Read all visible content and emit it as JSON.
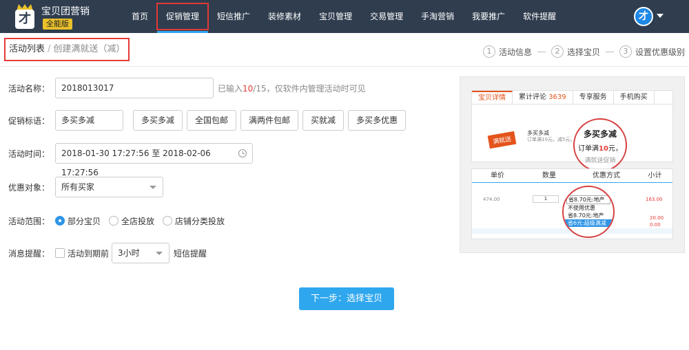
{
  "app": {
    "title": "宝贝团营销",
    "badge": "全能版",
    "logo_char": "才"
  },
  "nav": {
    "items": [
      {
        "label": "首页"
      },
      {
        "label": "促销管理",
        "active": true
      },
      {
        "label": "短信推广"
      },
      {
        "label": "装修素材"
      },
      {
        "label": "宝贝管理"
      },
      {
        "label": "交易管理"
      },
      {
        "label": "手淘营销"
      },
      {
        "label": "我要推广"
      },
      {
        "label": "软件提醒"
      }
    ]
  },
  "user": {
    "avatar_char": "才"
  },
  "breadcrumb": {
    "parent": "活动列表",
    "separator": "/",
    "current": "创建满就送（减）"
  },
  "steps": [
    {
      "num": "1",
      "label": "活动信息"
    },
    {
      "num": "2",
      "label": "选择宝贝"
    },
    {
      "num": "3",
      "label": "设置优惠级别"
    }
  ],
  "form": {
    "name": {
      "label": "活动名称：",
      "value": "2018013017",
      "hint_prefix": "已输入",
      "hint_count": "10",
      "hint_suffix": "/15，仅软件内管理活动时可见"
    },
    "slogan": {
      "label": "促销标语：",
      "value": "多买多减",
      "tags": [
        "多买多减",
        "全国包邮",
        "满两件包邮",
        "买就减",
        "多买多优惠"
      ]
    },
    "time": {
      "label": "活动时间：",
      "value": "2018-01-30 17:27:56 至 2018-02-06 17:27:56"
    },
    "target": {
      "label": "优惠对象：",
      "value": "所有买家"
    },
    "scope": {
      "label": "活动范围：",
      "options": [
        "部分宝贝",
        "全店投放",
        "店铺分类投放"
      ],
      "selected": "部分宝贝"
    },
    "reminder": {
      "label": "消息提醒：",
      "checkbox_label": "活动到期前",
      "checked": false,
      "interval": "3小时",
      "suffix": "短信提醒"
    }
  },
  "next_button": {
    "label": "下一步：选择宝贝"
  },
  "preview": {
    "tabs": [
      "宝贝详情",
      "累计评论",
      "专享服务",
      "手机购买"
    ],
    "review_count": "3639",
    "badge": "满就送",
    "promo_title": "多买多减",
    "promo_detail": "订单满10元，减5元。",
    "promo_note": "满就送促销",
    "circle1": {
      "title": "多买多减",
      "line_prefix": "订单满",
      "line_amount": "10",
      "line_suffix": "元，",
      "line3": "满就送促销"
    },
    "table_headers": [
      "单价",
      "数量",
      "优惠方式",
      "小计"
    ],
    "price": "474.00",
    "qty": "1",
    "subtotal": "163.00",
    "subtotal2": "20.00",
    "subtotal3": "0.00",
    "circle2_rows": [
      "省8.70元:地产",
      "不使用优惠",
      "省8.70元:地产",
      "省6元:超级满减"
    ]
  },
  "colors": {
    "nav_bg": "#2f3d4f",
    "accent": "#2fa7ee",
    "highlight_red": "#e53935",
    "badge_yellow": "#e9c02a"
  }
}
